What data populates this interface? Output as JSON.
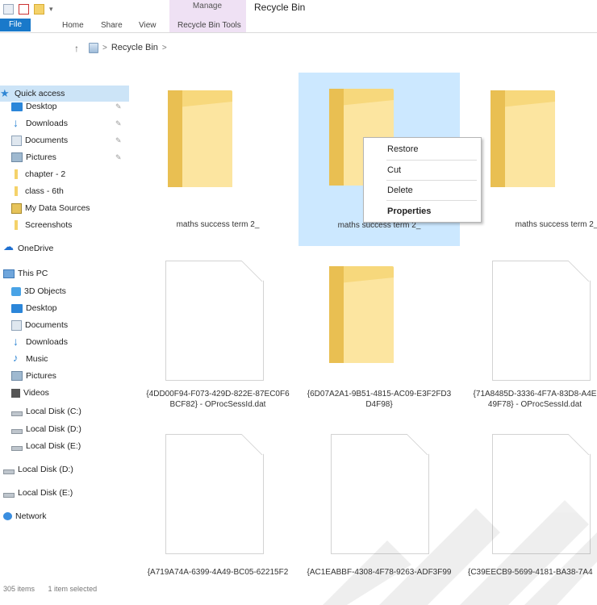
{
  "window": {
    "title": "Recycle Bin",
    "context_tab_label": "Manage"
  },
  "ribbon": {
    "tabs": [
      "File",
      "Home",
      "Share",
      "View",
      "Recycle Bin Tools"
    ]
  },
  "address": {
    "path": "Recycle Bin"
  },
  "sidebar": {
    "items": [
      {
        "label": "Quick access",
        "icon": "star-icon",
        "selected": true
      },
      {
        "label": "Desktop",
        "icon": "desktop-icon",
        "pinned": true
      },
      {
        "label": "Downloads",
        "icon": "downloads-icon",
        "pinned": true
      },
      {
        "label": "Documents",
        "icon": "documents-icon",
        "pinned": true
      },
      {
        "label": "Pictures",
        "icon": "pictures-icon",
        "pinned": true
      },
      {
        "label": "chapter - 2",
        "icon": "folder-icon"
      },
      {
        "label": "class - 6th",
        "icon": "folder-icon"
      },
      {
        "label": "My Data Sources",
        "icon": "data-sources-icon"
      },
      {
        "label": "Screenshots",
        "icon": "folder-icon"
      },
      {
        "label": "OneDrive",
        "icon": "onedrive-icon"
      },
      {
        "label": "This PC",
        "icon": "pc-icon"
      },
      {
        "label": "3D Objects",
        "icon": "3d-objects-icon"
      },
      {
        "label": "Desktop",
        "icon": "desktop-icon"
      },
      {
        "label": "Documents",
        "icon": "documents-icon"
      },
      {
        "label": "Downloads",
        "icon": "downloads-icon"
      },
      {
        "label": "Music",
        "icon": "music-icon"
      },
      {
        "label": "Pictures",
        "icon": "pictures-icon"
      },
      {
        "label": "Videos",
        "icon": "videos-icon"
      },
      {
        "label": "Local Disk (C:)",
        "icon": "disk-icon"
      },
      {
        "label": "Local Disk (D:)",
        "icon": "disk-icon"
      },
      {
        "label": "Local Disk (E:)",
        "icon": "disk-icon"
      },
      {
        "label": "Local Disk (D:)",
        "icon": "disk-icon"
      },
      {
        "label": "Local Disk (E:)",
        "icon": "disk-icon"
      },
      {
        "label": "Network",
        "icon": "network-icon"
      }
    ]
  },
  "items": [
    {
      "name": "maths success term 2_",
      "type": "folder"
    },
    {
      "name": "maths success term 2_",
      "type": "folder",
      "selected": true
    },
    {
      "name": "maths success term 2_",
      "type": "folder"
    },
    {
      "name": "{4DD00F94-F073-429D-822E-87EC0F6 BCF82} - OProcSessId.dat",
      "type": "file"
    },
    {
      "name": "{6D07A2A1-9B51-4815-AC09-E3F2FD3 D4F98}",
      "type": "folder"
    },
    {
      "name": "{71A8485D-3336-4F7A-83D8-A4E 49F78} - OProcSessId.dat",
      "type": "file"
    },
    {
      "name": "{A719A74A-6399-4A49-BC05-62215F2",
      "type": "file"
    },
    {
      "name": "{AC1EABBF-4308-4F78-9263-ADF3F99",
      "type": "file"
    },
    {
      "name": "{C39EECB9-5699-4181-BA38-7A4",
      "type": "file"
    }
  ],
  "context_menu": {
    "items": [
      "Restore",
      "Cut",
      "Delete",
      "Properties"
    ]
  },
  "status": {
    "count": "305 items",
    "selected": "1 item selected"
  }
}
